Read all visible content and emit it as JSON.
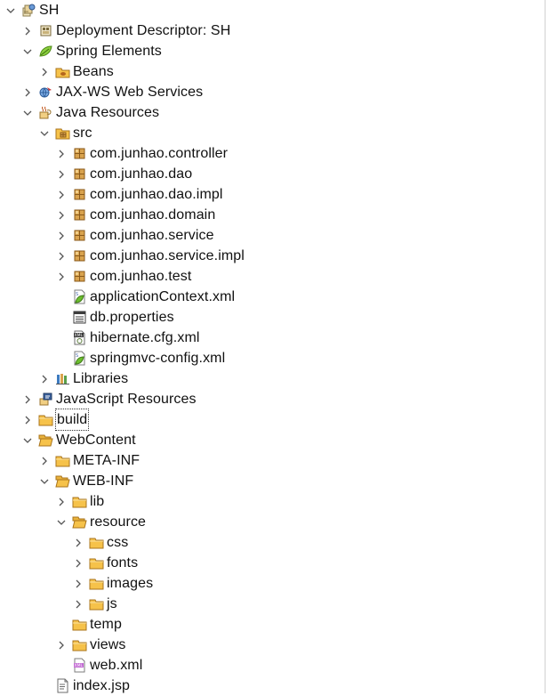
{
  "tree": [
    {
      "label": "SH",
      "depth": 0,
      "state": "expanded",
      "icon": "project-icon"
    },
    {
      "label": "Deployment Descriptor: SH",
      "depth": 1,
      "state": "collapsed",
      "icon": "deployment-descriptor-icon"
    },
    {
      "label": "Spring Elements",
      "depth": 1,
      "state": "expanded",
      "icon": "spring-leaf-icon"
    },
    {
      "label": "Beans",
      "depth": 2,
      "state": "collapsed",
      "icon": "beans-icon"
    },
    {
      "label": "JAX-WS Web Services",
      "depth": 1,
      "state": "collapsed",
      "icon": "web-services-icon"
    },
    {
      "label": "Java Resources",
      "depth": 1,
      "state": "expanded",
      "icon": "java-resources-icon"
    },
    {
      "label": "src",
      "depth": 2,
      "state": "expanded",
      "icon": "source-folder-icon"
    },
    {
      "label": "com.junhao.controller",
      "depth": 3,
      "state": "collapsed",
      "icon": "package-icon"
    },
    {
      "label": "com.junhao.dao",
      "depth": 3,
      "state": "collapsed",
      "icon": "package-icon"
    },
    {
      "label": "com.junhao.dao.impl",
      "depth": 3,
      "state": "collapsed",
      "icon": "package-icon"
    },
    {
      "label": "com.junhao.domain",
      "depth": 3,
      "state": "collapsed",
      "icon": "package-icon"
    },
    {
      "label": "com.junhao.service",
      "depth": 3,
      "state": "collapsed",
      "icon": "package-icon"
    },
    {
      "label": "com.junhao.service.impl",
      "depth": 3,
      "state": "collapsed",
      "icon": "package-icon"
    },
    {
      "label": "com.junhao.test",
      "depth": 3,
      "state": "collapsed",
      "icon": "package-icon"
    },
    {
      "label": "applicationContext.xml",
      "depth": 3,
      "state": "leaf",
      "icon": "spring-xml-file-icon"
    },
    {
      "label": "db.properties",
      "depth": 3,
      "state": "leaf",
      "icon": "properties-file-icon"
    },
    {
      "label": "hibernate.cfg.xml",
      "depth": 3,
      "state": "leaf",
      "icon": "hibernate-xml-file-icon"
    },
    {
      "label": "springmvc-config.xml",
      "depth": 3,
      "state": "leaf",
      "icon": "spring-xml-file-icon"
    },
    {
      "label": "Libraries",
      "depth": 2,
      "state": "collapsed",
      "icon": "libraries-icon"
    },
    {
      "label": "JavaScript Resources",
      "depth": 1,
      "state": "collapsed",
      "icon": "javascript-resources-icon"
    },
    {
      "label": "build",
      "depth": 1,
      "state": "collapsed",
      "icon": "folder-icon",
      "focused": true
    },
    {
      "label": "WebContent",
      "depth": 1,
      "state": "expanded",
      "icon": "folder-open-icon"
    },
    {
      "label": "META-INF",
      "depth": 2,
      "state": "collapsed",
      "icon": "folder-icon"
    },
    {
      "label": "WEB-INF",
      "depth": 2,
      "state": "expanded",
      "icon": "folder-open-icon"
    },
    {
      "label": "lib",
      "depth": 3,
      "state": "collapsed",
      "icon": "folder-icon"
    },
    {
      "label": "resource",
      "depth": 3,
      "state": "expanded",
      "icon": "folder-open-icon"
    },
    {
      "label": "css",
      "depth": 4,
      "state": "collapsed",
      "icon": "folder-icon"
    },
    {
      "label": "fonts",
      "depth": 4,
      "state": "collapsed",
      "icon": "folder-icon"
    },
    {
      "label": "images",
      "depth": 4,
      "state": "collapsed",
      "icon": "folder-icon"
    },
    {
      "label": "js",
      "depth": 4,
      "state": "collapsed",
      "icon": "folder-icon"
    },
    {
      "label": "temp",
      "depth": 3,
      "state": "leaf",
      "icon": "folder-icon"
    },
    {
      "label": "views",
      "depth": 3,
      "state": "collapsed",
      "icon": "folder-icon"
    },
    {
      "label": "web.xml",
      "depth": 3,
      "state": "leaf",
      "icon": "xml-file-icon"
    },
    {
      "label": "index.jsp",
      "depth": 2,
      "state": "leaf",
      "icon": "jsp-file-icon"
    }
  ]
}
